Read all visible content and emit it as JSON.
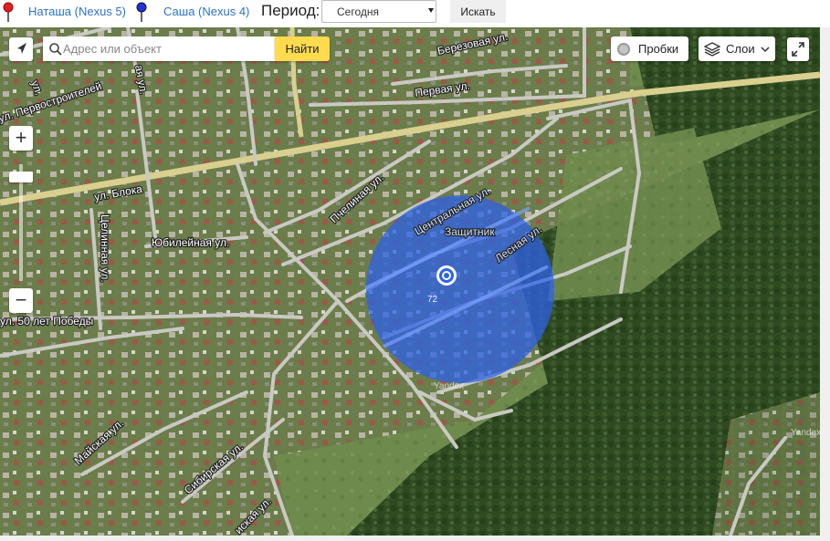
{
  "devices": [
    {
      "label": "Наташа (Nexus 5)",
      "pin_color": "#e02020"
    },
    {
      "label": "Саша (Nexus 4)",
      "pin_color": "#2233dd"
    }
  ],
  "period": {
    "label": "Период:",
    "selected": "Сегодня"
  },
  "search_button": "Искать",
  "map": {
    "search_placeholder": "Адрес или объект",
    "find_button": "Найти",
    "traffic_button": "Пробки",
    "layers_button": "Слои",
    "zoom_in": "+",
    "zoom_out": "−",
    "streets": {
      "berezovaya": "Березовая ул.",
      "pervaya": "Первая ул.",
      "pervostroiteley": "ул. Первостроителей",
      "bloka": "ул. Блока",
      "tselinnaya": "Целинная ул.",
      "yubileynaya": "Юбилейная ул.",
      "pchelinaya": "Пчелиная ул.",
      "tsentralnaya": "Центральная ул.",
      "lesnaya": "Лесная ул.",
      "zashchitnik": "Защитник",
      "pobedy": "ул. 50 лет Победы",
      "mayskaya": "Майская ул.",
      "sibirskaya": "Сибирская ул.",
      "iskaya": "иская ул.",
      "left_ul": "ул.",
      "left_aya": "ая ул."
    },
    "house_number": "72",
    "watermark": "Yandex",
    "accuracy_color": "#2e62e8"
  }
}
